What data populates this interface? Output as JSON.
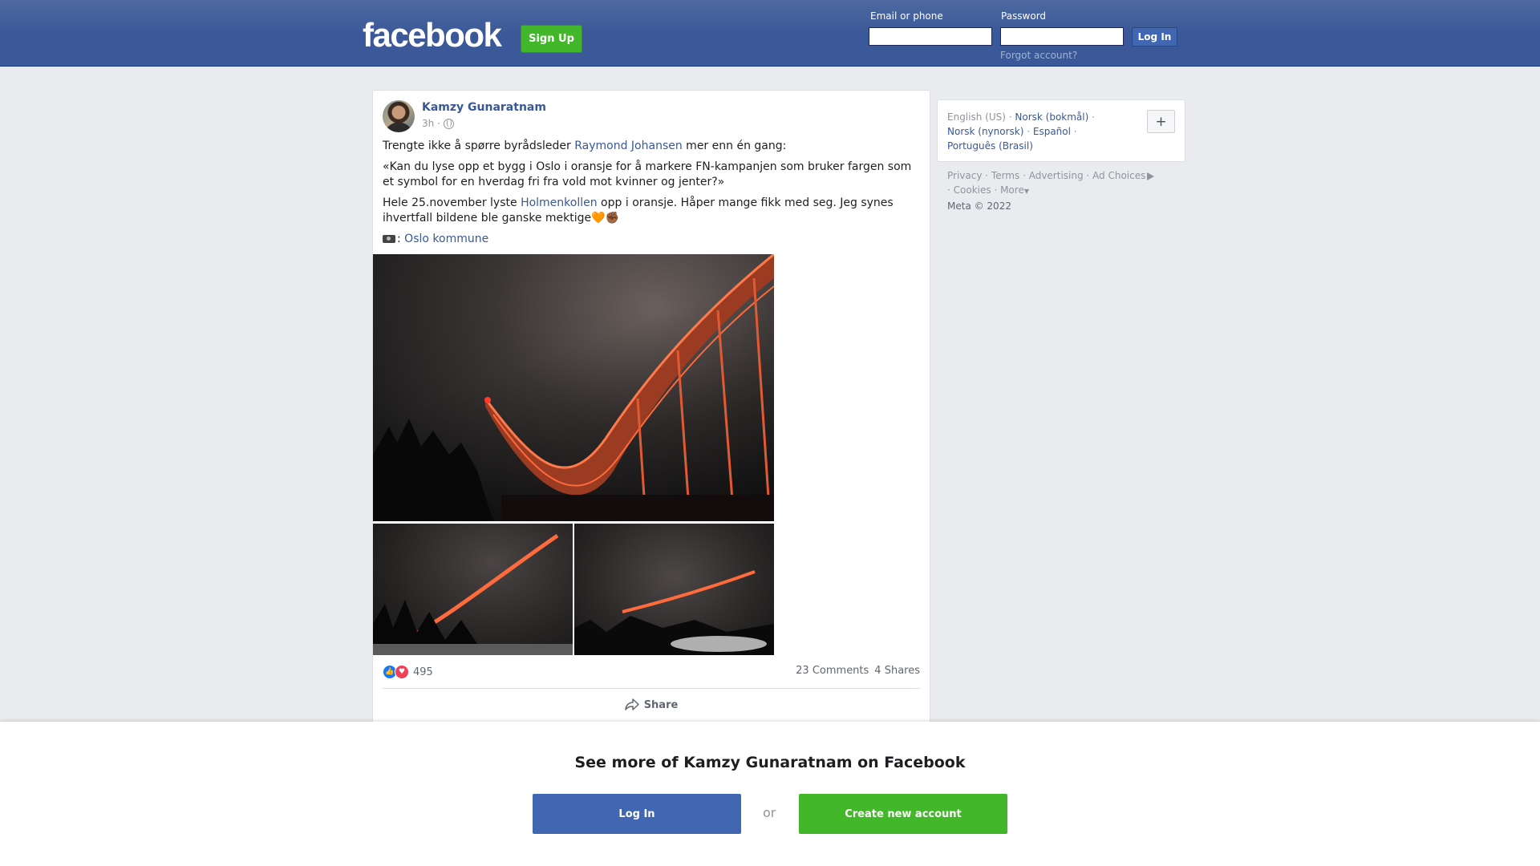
{
  "header": {
    "logo": "facebook",
    "signup_label": "Sign Up",
    "email_label": "Email or phone",
    "password_label": "Password",
    "login_label": "Log In",
    "forgot_label": "Forgot account?"
  },
  "post": {
    "author": "Kamzy Gunaratnam",
    "time": "3h",
    "line1_pre": "Trengte ikke å spørre byrådsleder ",
    "line1_link": "Raymond Johansen",
    "line1_post": " mer enn én gang:",
    "quote": "«Kan du lyse opp et bygg i Oslo i oransje for å markere FN-kampanjen som bruker fargen som et symbol for en hverdag fri fra vold mot kvinner og jenter?»",
    "line3_pre": "Hele 25.november lyste ",
    "line3_link": "Holmenkollen",
    "line3_post": " opp i oransje. Håper mange fikk med seg. Jeg synes ihvertfall bildene ble ganske mektige🧡✊🏾",
    "credit_sep": ": ",
    "credit_link": "Oslo kommune",
    "reaction_count": "495",
    "comments": "23 Comments",
    "shares": "4 Shares",
    "share_label": "Share"
  },
  "sidebar": {
    "languages": [
      "English (US)",
      "Norsk (bokmål)",
      "Norsk (nynorsk)",
      "Español",
      "Português (Brasil)"
    ],
    "footer_links": [
      "Privacy",
      "Terms",
      "Advertising",
      "Ad Choices",
      "Cookies",
      "More"
    ],
    "copyright": "Meta © 2022",
    "plus_label": "+"
  },
  "overlay": {
    "title": "See more of Kamzy Gunaratnam on Facebook",
    "login_label": "Log In",
    "or_label": "or",
    "create_label": "Create new account"
  },
  "colors": {
    "brand_blue": "#3b5998",
    "link_blue": "#385898",
    "green": "#42b72a",
    "bg": "#e9ebee"
  }
}
